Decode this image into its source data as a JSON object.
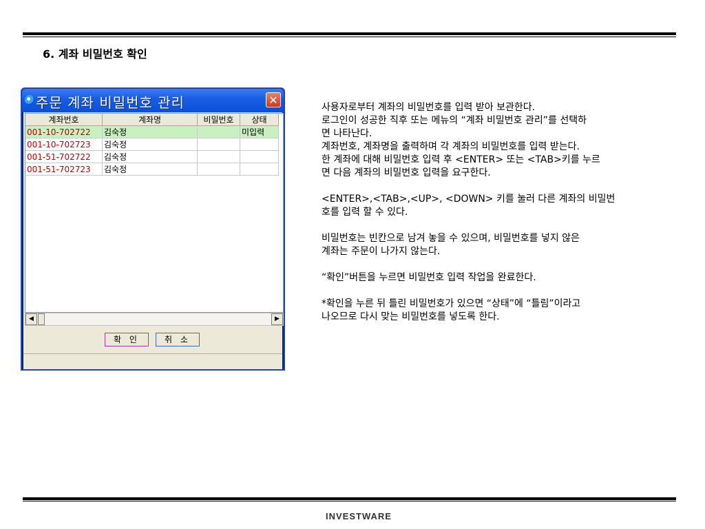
{
  "section_title": "6. 계좌 비밀번호 확인",
  "window": {
    "title": "주문 계좌 비밀번호 관리",
    "close_label": "✕",
    "columns": [
      "계좌번호",
      "계좌명",
      "비밀번호",
      "상태"
    ],
    "rows": [
      {
        "account": "001-10-702722",
        "name": "김숙정",
        "password": "",
        "status": "미입력"
      },
      {
        "account": "001-10-702723",
        "name": "김숙정",
        "password": "",
        "status": ""
      },
      {
        "account": "001-51-702722",
        "name": "김숙정",
        "password": "",
        "status": ""
      },
      {
        "account": "001-51-702723",
        "name": "김숙정",
        "password": "",
        "status": ""
      }
    ],
    "ok_label": "확 인",
    "cancel_label": "취 소"
  },
  "description": {
    "p1_line1": "사용자로부터 계좌의 비밀번호를 입력 받아 보관한다.",
    "p1_line2": "로그인이 성공한 직후 또는 메뉴의 “계좌 비밀번호 관리”를 선택하",
    "p1_line3": "면 나타난다.",
    "p1_line4": "계좌번호, 계좌명을 출력하며 각 계좌의 비밀번호를 입력 받는다.",
    "p1_line5": "한 계좌에 대해 비밀번호 입력 후 <ENTER> 또는 <TAB>키를 누르",
    "p1_line6": "면 다음 계좌의 비밀번호 입력을 요구한다.",
    "p2_line1": "<ENTER>,<TAB>,<UP>, <DOWN> 키를 눌러 다른 계좌의 비밀번",
    "p2_line2": "호를 입력 할 수 있다.",
    "p3_line1": "비밀번호는 빈칸으로 남겨 놓을 수 있으며, 비밀번호를 넣지 않은",
    "p3_line2": "계좌는 주문이 나가지 않는다.",
    "p4_line1": "“확인”버튼을 누르면 비밀번호 입력 작업을 완료한다.",
    "p5_line1": "*확인을 누른 뒤 틀린 비밀번호가 있으면 “상태”에 “틀림”이라고",
    "p5_line2": "나오므로 다시 맞는 비밀번호를 넣도록 한다."
  },
  "footer": {
    "logo": "INVESTWARE"
  }
}
